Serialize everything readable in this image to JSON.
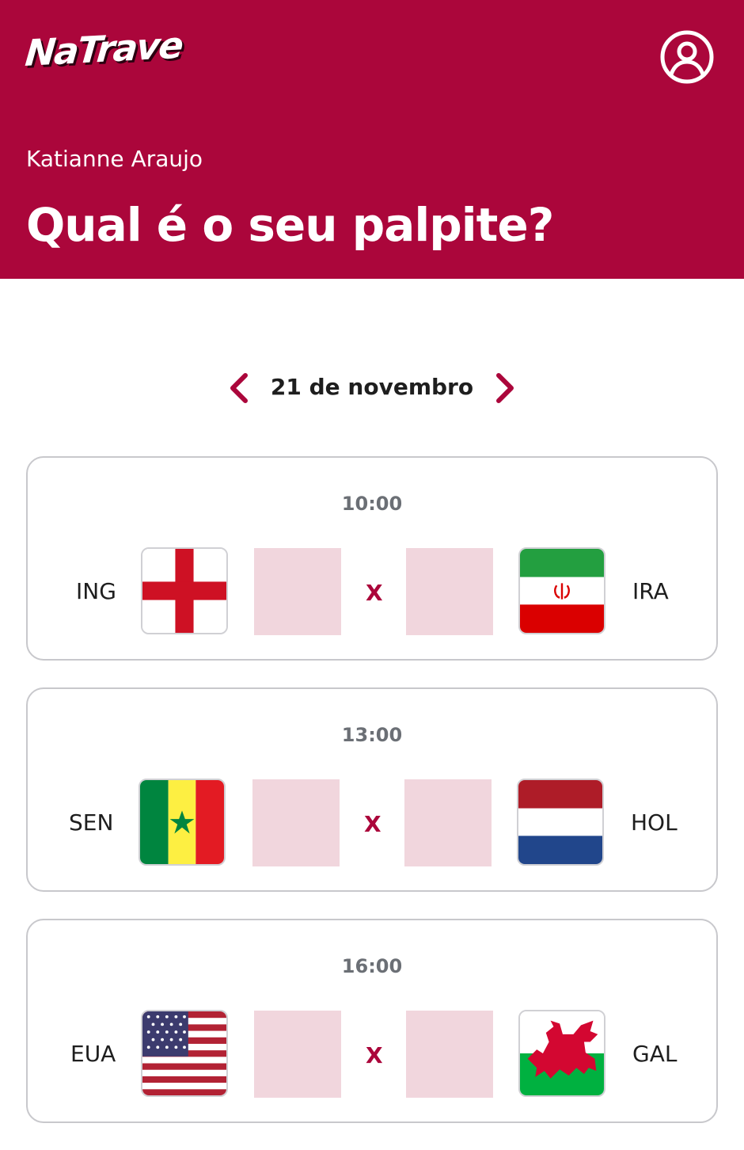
{
  "header": {
    "logo": "NaTrave",
    "profile_icon": "user-circle-icon",
    "user_name": "Katianne Araujo",
    "title": "Qual é o seu palpite?",
    "background_color": "#ab063b"
  },
  "date_nav": {
    "prev_icon": "chevron-left-icon",
    "next_icon": "chevron-right-icon",
    "date": "21 de novembro"
  },
  "matches": [
    {
      "time": "10:00",
      "home": {
        "code": "ING",
        "flag": "england-flag-icon",
        "score": ""
      },
      "separator": "X",
      "away": {
        "code": "IRA",
        "flag": "iran-flag-icon",
        "score": ""
      }
    },
    {
      "time": "13:00",
      "home": {
        "code": "SEN",
        "flag": "senegal-flag-icon",
        "score": ""
      },
      "separator": "X",
      "away": {
        "code": "HOL",
        "flag": "netherlands-flag-icon",
        "score": ""
      }
    },
    {
      "time": "16:00",
      "home": {
        "code": "EUA",
        "flag": "usa-flag-icon",
        "score": ""
      },
      "separator": "X",
      "away": {
        "code": "GAL",
        "flag": "wales-flag-icon",
        "score": ""
      }
    }
  ],
  "colors": {
    "accent": "#ab063b",
    "score_box": "#f1d6dd",
    "time_text": "#6b6f75"
  }
}
